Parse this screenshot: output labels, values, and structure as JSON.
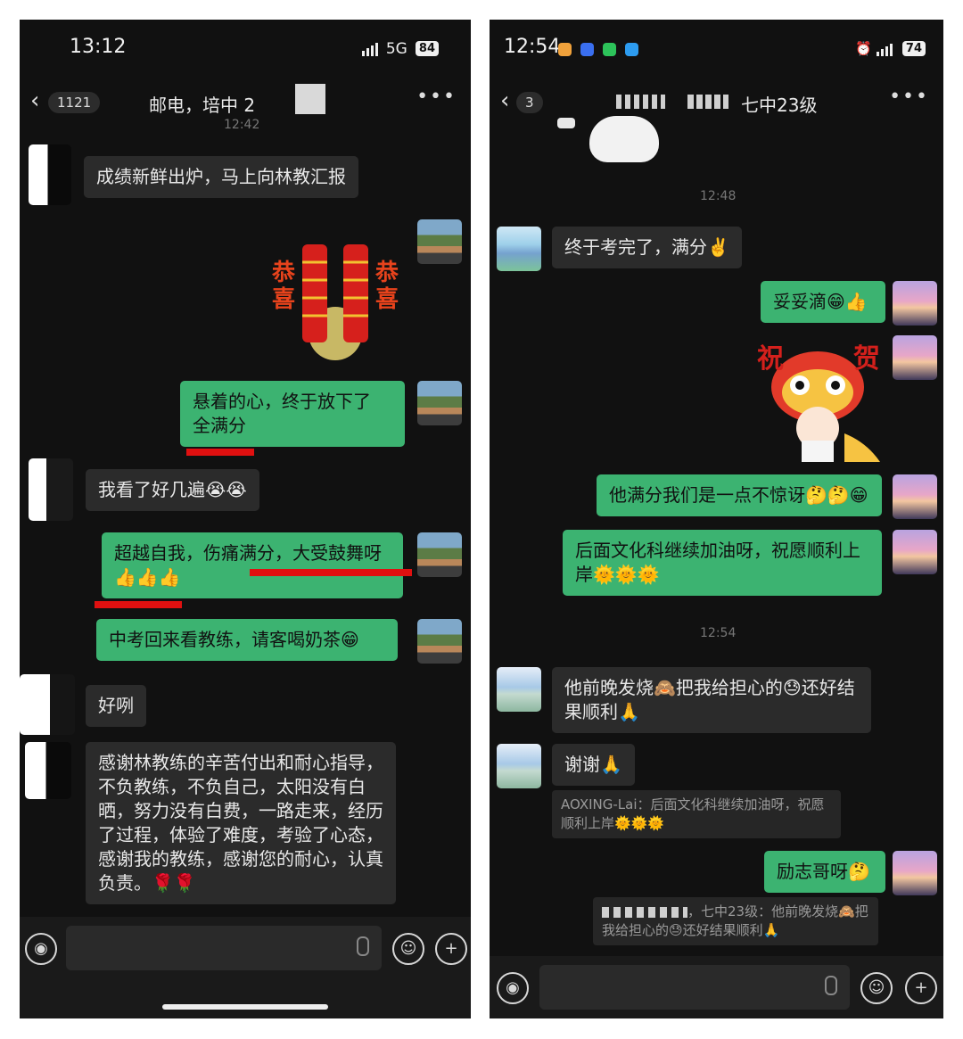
{
  "left": {
    "status": {
      "time": "13:12",
      "network": "5G",
      "battery": "84"
    },
    "nav": {
      "unread": "1121",
      "title": "邮电，培中 2"
    },
    "timestamp": "12:42",
    "messages": {
      "m1": "成绩新鲜出炉，马上向林教汇报",
      "m2": "悬着的心，终于放下了 全满分",
      "m3": "我看了好几遍😭😭",
      "m4": "超越自我，伤痛满分，大受鼓舞呀👍👍👍",
      "m5": "中考回来看教练，请客喝奶茶😁",
      "m6": "好咧",
      "m7": "感谢林教练的辛苦付出和耐心指导，不负教练，不负自己，太阳没有白晒，努力没有白费，一路走来，经历了过程，体验了难度，考验了心态，感谢我的教练，感谢您的耐心，认真负责。🌹🌹"
    },
    "sticker": {
      "left_text": "恭喜",
      "right_text": "恭喜"
    }
  },
  "right": {
    "status": {
      "time": "12:54",
      "battery": "74"
    },
    "nav": {
      "unread": "3",
      "title": "七中23级"
    },
    "timestamps": {
      "t1": "12:48",
      "t2": "12:54"
    },
    "messages": {
      "r1": "终于考完了，满分✌️",
      "r2": "妥妥滴😁👍",
      "r3": "他满分我们是一点不惊讶🤔🤔😁",
      "r4": "后面文化科继续加油呀，祝愿顺利上岸🌞🌞🌞",
      "r5": "他前晚发烧🙈把我给担心的😓还好结果顺利🙏",
      "r6": "谢谢🙏",
      "r7": "励志哥呀🤔"
    },
    "quotes": {
      "q1": "AOXING-Lai：后面文化科继续加油呀，祝愿顺利上岸🌞🌞🌞",
      "q2": "，七中23级：他前晚发烧🙈把我给担心的😓还好结果顺利🙏"
    },
    "sticker": {
      "text_left": "祝",
      "text_right": "贺"
    }
  },
  "colors": {
    "green_bubble": "#3cb371",
    "dark_bg": "#111111",
    "gray_bubble": "#2b2b2b",
    "underline": "#e01010"
  }
}
